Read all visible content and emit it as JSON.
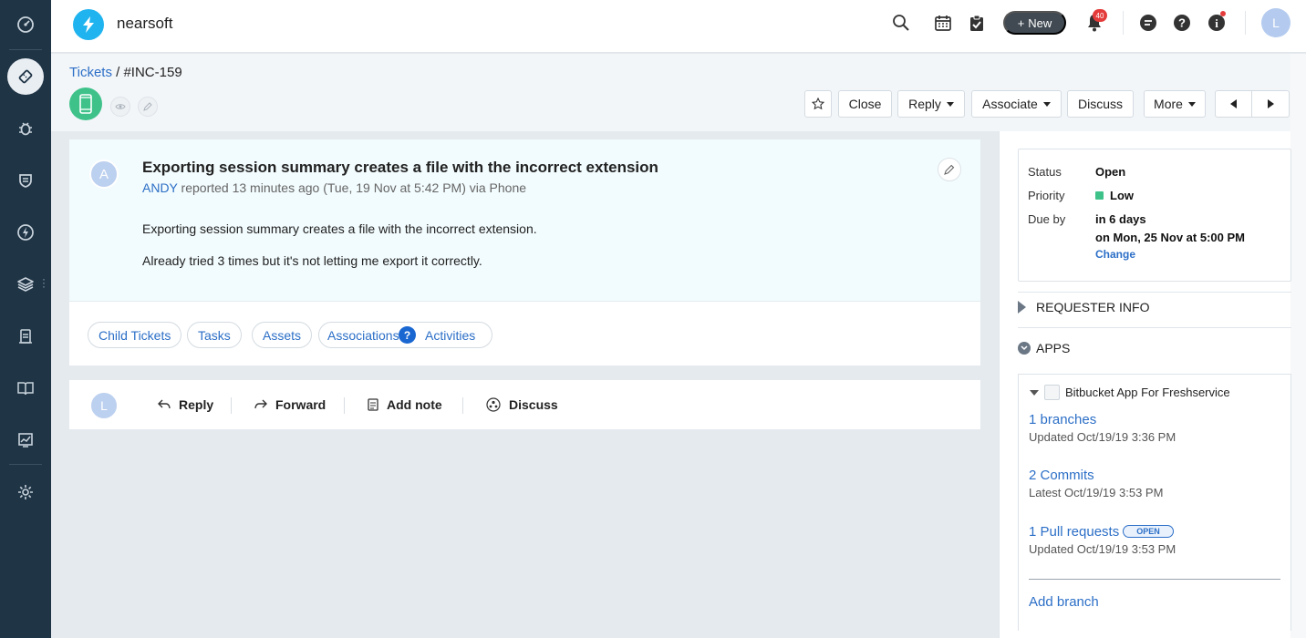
{
  "topbar": {
    "brand": "nearsoft",
    "new_label": "New",
    "notification_count": "40",
    "avatar_initial": "L"
  },
  "breadcrumb": {
    "root": "Tickets",
    "separator": " / ",
    "current": "#INC-159"
  },
  "actions": {
    "close": "Close",
    "reply": "Reply",
    "associate": "Associate",
    "discuss": "Discuss",
    "more": "More"
  },
  "ticket": {
    "avatar_initial": "A",
    "title": "Exporting session summary creates a file with the incorrect extension",
    "requester": "ANDY",
    "meta": " reported 13 minutes ago (Tue, 19 Nov at 5:42 PM) via Phone",
    "body_line1": "Exporting session summary creates a file with the incorrect extension.",
    "body_line2": "Already tried 3 times but it's not letting me export it correctly."
  },
  "tabs": {
    "child_tickets": "Child Tickets",
    "tasks": "Tasks",
    "assets": "Assets",
    "associations": "Associations",
    "activities": "Activities",
    "help_mark": "?"
  },
  "reply_bar": {
    "avatar_initial": "L",
    "reply": "Reply",
    "forward": "Forward",
    "add_note": "Add note",
    "discuss": "Discuss"
  },
  "properties": {
    "status_label": "Status",
    "status_value": "Open",
    "priority_label": "Priority",
    "priority_value": "Low",
    "priority_color": "#3ec28a",
    "due_label": "Due by",
    "due_relative": "in 6 days",
    "due_absolute": "on Mon, 25 Nov at 5:00 PM",
    "change_link": "Change"
  },
  "sections": {
    "requester_info": "REQUESTER INFO",
    "apps": "APPS"
  },
  "app": {
    "name": "Bitbucket App For Freshservice",
    "branches_link": "1 branches",
    "branches_updated": "Updated Oct/19/19 3:36 PM",
    "commits_link": "2 Commits",
    "commits_latest": "Latest Oct/19/19 3:53 PM",
    "prs_link": "1 Pull requests",
    "prs_tag": "OPEN",
    "prs_updated": "Updated Oct/19/19 3:53 PM",
    "add_branch": "Add branch"
  },
  "colors": {
    "sidebar": "#1f3445",
    "accent": "#2c6fc7",
    "logo": "#1fb4ef",
    "source_phone": "#3ec28a"
  }
}
